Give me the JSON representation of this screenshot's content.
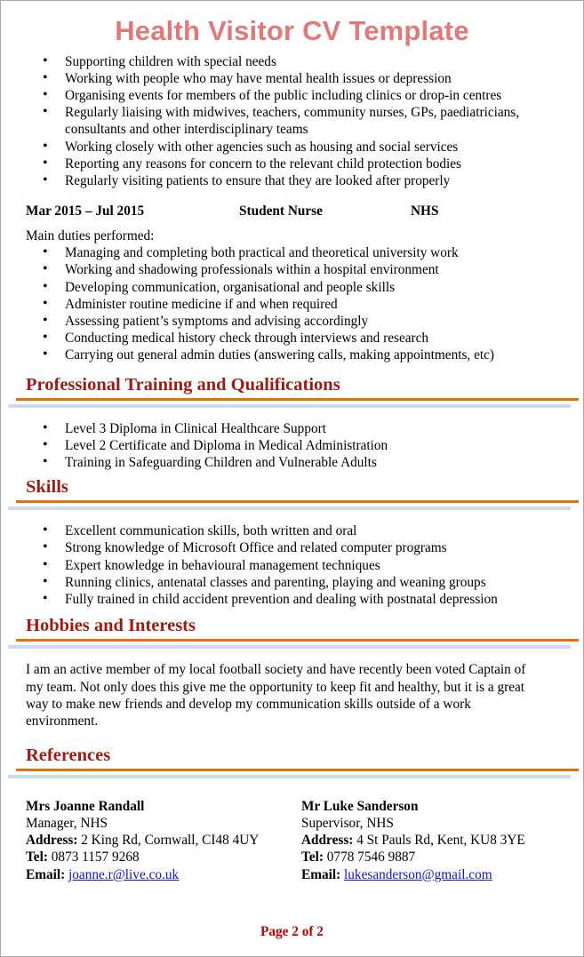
{
  "document": {
    "title": "Health Visitor CV Template",
    "footer": "Page 2 of 2"
  },
  "colors": {
    "title": "#E07A7A",
    "heading": "#9E1B14",
    "rule_primary": "#E2710D",
    "rule_secondary": "#CCDBF0",
    "link": "#1414C8",
    "footer": "#C00000",
    "page_border": "#A9A9A9"
  },
  "top_duties": [
    "Supporting children with special needs",
    "Working with people who may have mental health issues or depression",
    "Organising events for members of the public including clinics or drop-in centres",
    "Regularly liaising with midwives, teachers, community nurses, GPs, paediatricians, consultants and other interdisciplinary teams",
    "Working closely with other agencies such as housing and social services",
    "Reporting any reasons for concern to the relevant child protection bodies",
    "Regularly visiting patients to ensure that they are looked after properly"
  ],
  "job": {
    "dates": "Mar 2015 – Jul 2015",
    "role": "Student Nurse",
    "organisation": "NHS",
    "duties_label": "Main duties performed:",
    "duties": [
      "Managing and completing both practical and theoretical university work",
      "Working and shadowing professionals within a hospital environment",
      "Developing communication, organisational and people skills",
      "Administer routine medicine if and when required",
      "Assessing patient’s symptoms and advising accordingly",
      "Conducting medical history check through interviews and research",
      "Carrying out general admin duties (answering calls, making appointments, etc)"
    ]
  },
  "sections": {
    "training": {
      "heading": "Professional Training and Qualifications",
      "items": [
        "Level 3 Diploma in Clinical Healthcare Support",
        "Level 2 Certificate and Diploma in Medical Administration",
        "Training in Safeguarding Children and Vulnerable Adults"
      ]
    },
    "skills": {
      "heading": "Skills",
      "items": [
        "Excellent communication skills, both written and oral",
        "Strong knowledge of Microsoft Office and related computer programs",
        "Expert knowledge in behavioural management techniques",
        "Running clinics, antenatal classes and parenting, playing and weaning groups",
        "Fully trained in child accident prevention and dealing with postnatal depression"
      ]
    },
    "hobbies": {
      "heading": "Hobbies and Interests",
      "paragraph": "I am an active member of my local football society and have recently been voted Captain of my team. Not only does this give me the opportunity to keep fit and healthy, but it is a great way to make new friends and develop my communication skills outside of a work environment."
    },
    "references": {
      "heading": "References",
      "labels": {
        "address": "Address:",
        "tel": "Tel:",
        "email": "Email:"
      },
      "entries": [
        {
          "name": "Mrs Joanne Randall",
          "position": "Manager, NHS",
          "address": "2 King Rd, Cornwall, CI48 4UY",
          "tel": "0873 1157 9268",
          "email": "joanne.r@live.co.uk"
        },
        {
          "name": "Mr Luke Sanderson",
          "position": "Supervisor, NHS",
          "address": "4 St Pauls Rd, Kent, KU8 3YE",
          "tel": "0778 7546 9887",
          "email": "lukesanderson@gmail.com"
        }
      ]
    }
  }
}
